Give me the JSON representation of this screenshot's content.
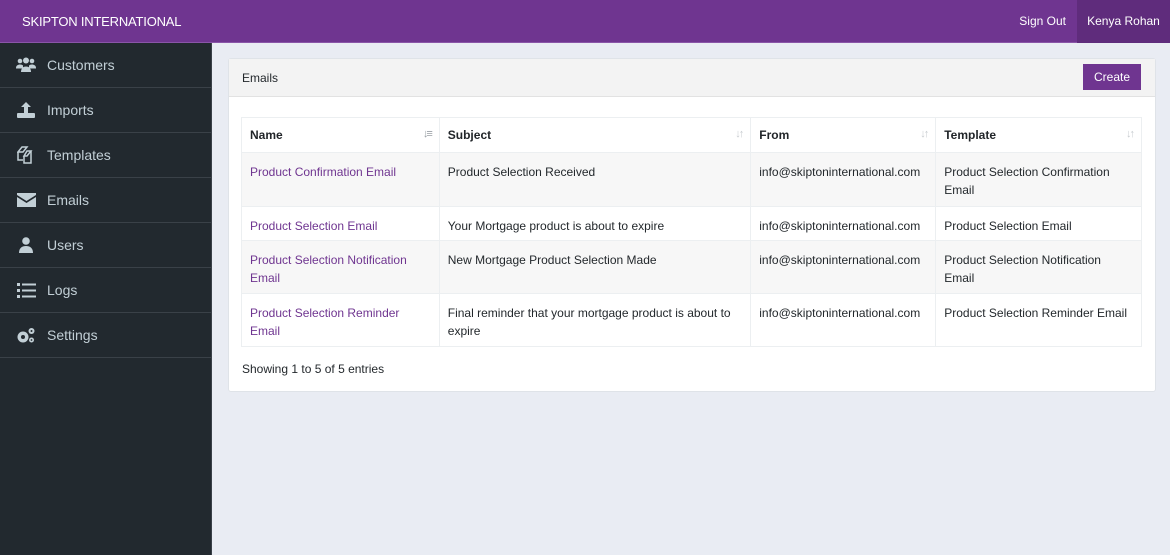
{
  "topbar": {
    "brand": "SKIPTON INTERNATIONAL",
    "sign_out": "Sign Out",
    "user_name": "Kenya Rohan"
  },
  "sidebar": {
    "items": [
      {
        "label": "Customers",
        "icon": "users-icon"
      },
      {
        "label": "Imports",
        "icon": "upload-icon"
      },
      {
        "label": "Templates",
        "icon": "copy-icon"
      },
      {
        "label": "Emails",
        "icon": "envelope-icon"
      },
      {
        "label": "Users",
        "icon": "user-icon"
      },
      {
        "label": "Logs",
        "icon": "list-icon"
      },
      {
        "label": "Settings",
        "icon": "cogs-icon"
      }
    ]
  },
  "card": {
    "title": "Emails",
    "create_label": "Create"
  },
  "table": {
    "columns": [
      "Name",
      "Subject",
      "From",
      "Template"
    ],
    "rows": [
      {
        "name": "Product Confirmation Email",
        "subject": "Product Selection Received",
        "from": "info@skiptoninternational.com",
        "template": "Product Selection Confirmation Email"
      },
      {
        "name": "Product Selection Email",
        "subject": "Your Mortgage product is about to expire",
        "from": "info@skiptoninternational.com",
        "template": "Product Selection Email"
      },
      {
        "name": "Product Selection Notification Email",
        "subject": "New Mortgage Product Selection Made",
        "from": "info@skiptoninternational.com",
        "template": "Product Selection Notification Email"
      },
      {
        "name": "Product Selection Reminder Email",
        "subject": "Final reminder that your mortgage product is about to expire",
        "from": "info@skiptoninternational.com",
        "template": "Product Selection Reminder Email"
      }
    ],
    "info": "Showing 1 to 5 of 5 entries"
  }
}
